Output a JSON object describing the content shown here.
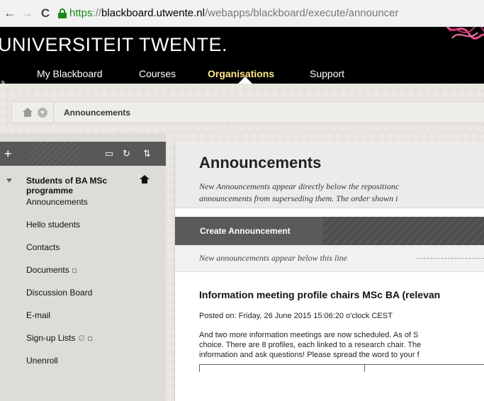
{
  "browser": {
    "url_scheme": "https",
    "url_sep": "://",
    "url_host": "blackboard.utwente.nl",
    "url_path": "/webapps/blackboard/execute/announcer",
    "back_icon": "back-arrow-icon",
    "forward_icon": "forward-arrow-icon",
    "reload_icon": "reload-icon",
    "lock_icon": "lock-icon",
    "secure_color": "#1a8a1a"
  },
  "header": {
    "university": "UNIVERSITEIT TWENTE.",
    "nav": [
      {
        "label": "My Blackboard"
      },
      {
        "label": "Courses"
      },
      {
        "label": "Organisations"
      },
      {
        "label": "Support"
      }
    ],
    "active_nav": "Organisations",
    "active_color": "#ffe88a"
  },
  "breadcrumb": {
    "current": "Announcements"
  },
  "left_toolbar": {
    "add": "+",
    "folder_icon": "folder-icon",
    "refresh_icon": "refresh-icon",
    "sort_icon": "sort-icon"
  },
  "course_menu": {
    "title_line1": "Students of BA MSc",
    "title_line2": "programme",
    "items": [
      {
        "label": "Announcements"
      },
      {
        "label": "Hello students"
      },
      {
        "label": "Contacts"
      },
      {
        "label": "Documents"
      },
      {
        "label": "Discussion Board"
      },
      {
        "label": "E-mail"
      },
      {
        "label": "Sign-up Lists"
      },
      {
        "label": "Unenroll"
      }
    ]
  },
  "page": {
    "title": "Announcements",
    "desc_line1": "New Announcements appear directly below the repositionc",
    "desc_line2": "announcements from superseding them. The order shown i",
    "create_button": "Create Announcement",
    "reposition_text": "New announcements appear below this line"
  },
  "announcement": {
    "title": "Information meeting profile chairs MSc BA (relevan",
    "posted": "Posted on: Friday, 26 June 2015 15:06:20 o'clock CEST",
    "body_lines": [
      "And two more information meetings are now scheduled. As of S",
      "choice. There are 8 profiles, each linked to a research chair. The",
      "information and ask questions! Please spread the word to your f"
    ]
  }
}
